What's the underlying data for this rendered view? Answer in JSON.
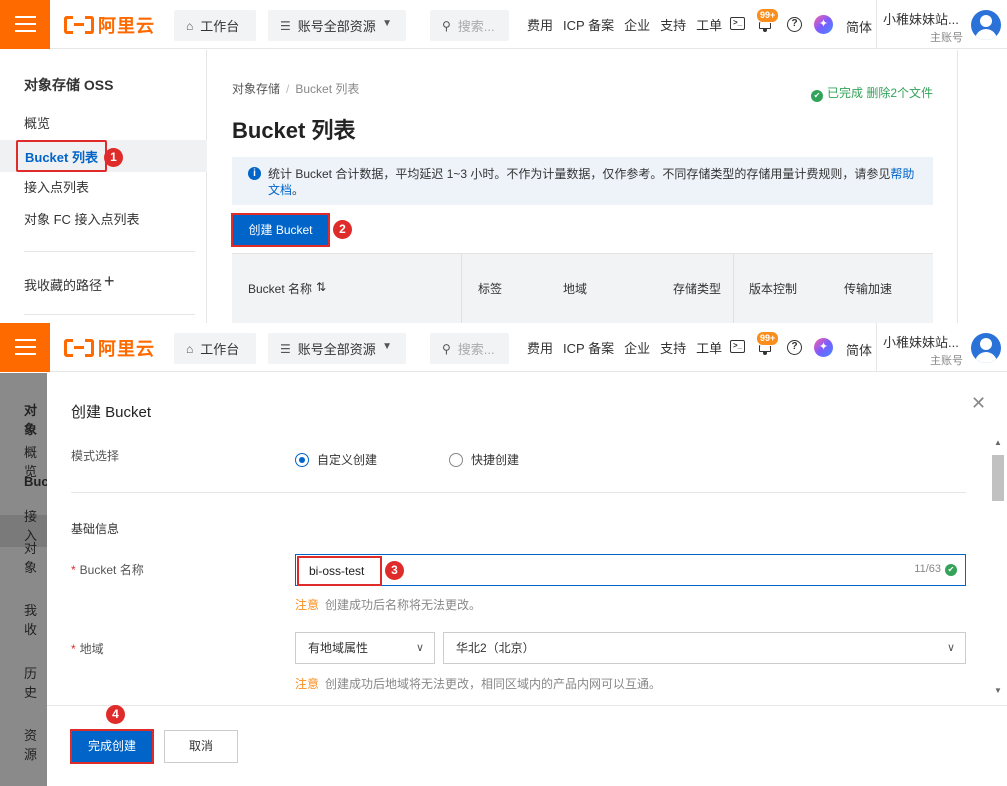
{
  "topnav": {
    "brand": "阿里云",
    "workbench": "工作台",
    "resources": "账号全部资源",
    "search_placeholder": "搜索...",
    "links": [
      "费用",
      "ICP 备案",
      "企业",
      "支持",
      "工单"
    ],
    "notification_badge": "99+",
    "language": "简体",
    "user_name": "小稚妹妹站...",
    "user_role": "主账号"
  },
  "sidebar": {
    "title": "对象存储 OSS",
    "items": [
      "概览",
      "Bucket 列表",
      "接入点列表",
      "对象 FC 接入点列表"
    ],
    "favorites": "我收藏的路径",
    "add_symbol": "+"
  },
  "main": {
    "breadcrumb": [
      "对象存储",
      "Bucket 列表"
    ],
    "status": "已完成 删除2个文件",
    "title": "Bucket 列表",
    "notice_text": "统计 Bucket 合计数据，平均延迟 1~3 小时。不作为计量数据，仅作参考。不同存储类型的存储用量计费规则，请参见",
    "notice_link": "帮助文档",
    "notice_tail": "。",
    "create_button": "创建 Bucket",
    "table_headers": [
      "Bucket 名称",
      "标签",
      "地域",
      "存储类型",
      "版本控制",
      "传输加速"
    ]
  },
  "steps": [
    "1",
    "2",
    "3",
    "4"
  ],
  "background_sidebar": [
    "对象",
    "概览",
    "Buc",
    "接入",
    "对象",
    "我收",
    "历史",
    "资源"
  ],
  "dialog": {
    "title": "创建 Bucket",
    "mode_label": "模式选择",
    "mode_options": [
      "自定义创建",
      "快捷创建"
    ],
    "mode_selected": "自定义创建",
    "section_basic": "基础信息",
    "name_label": "Bucket 名称",
    "name_value": "bi-oss-test",
    "name_counter": "11/63",
    "name_hint_tag": "注意",
    "name_hint": "创建成功后名称将无法更改。",
    "region_label": "地域",
    "region_attr": "有地域属性",
    "region_value": "华北2（北京）",
    "region_hint_tag": "注意",
    "region_hint": "创建成功后地域将无法更改，相同区域内的产品内网可以互通。",
    "finish_button": "完成创建",
    "cancel_button": "取消"
  },
  "colors": {
    "brand_orange": "#ff6a00",
    "primary_blue": "#0064c8",
    "highlight_red": "#e02b2b",
    "success_green": "#33a35a",
    "warning_orange": "#f98e1d"
  }
}
